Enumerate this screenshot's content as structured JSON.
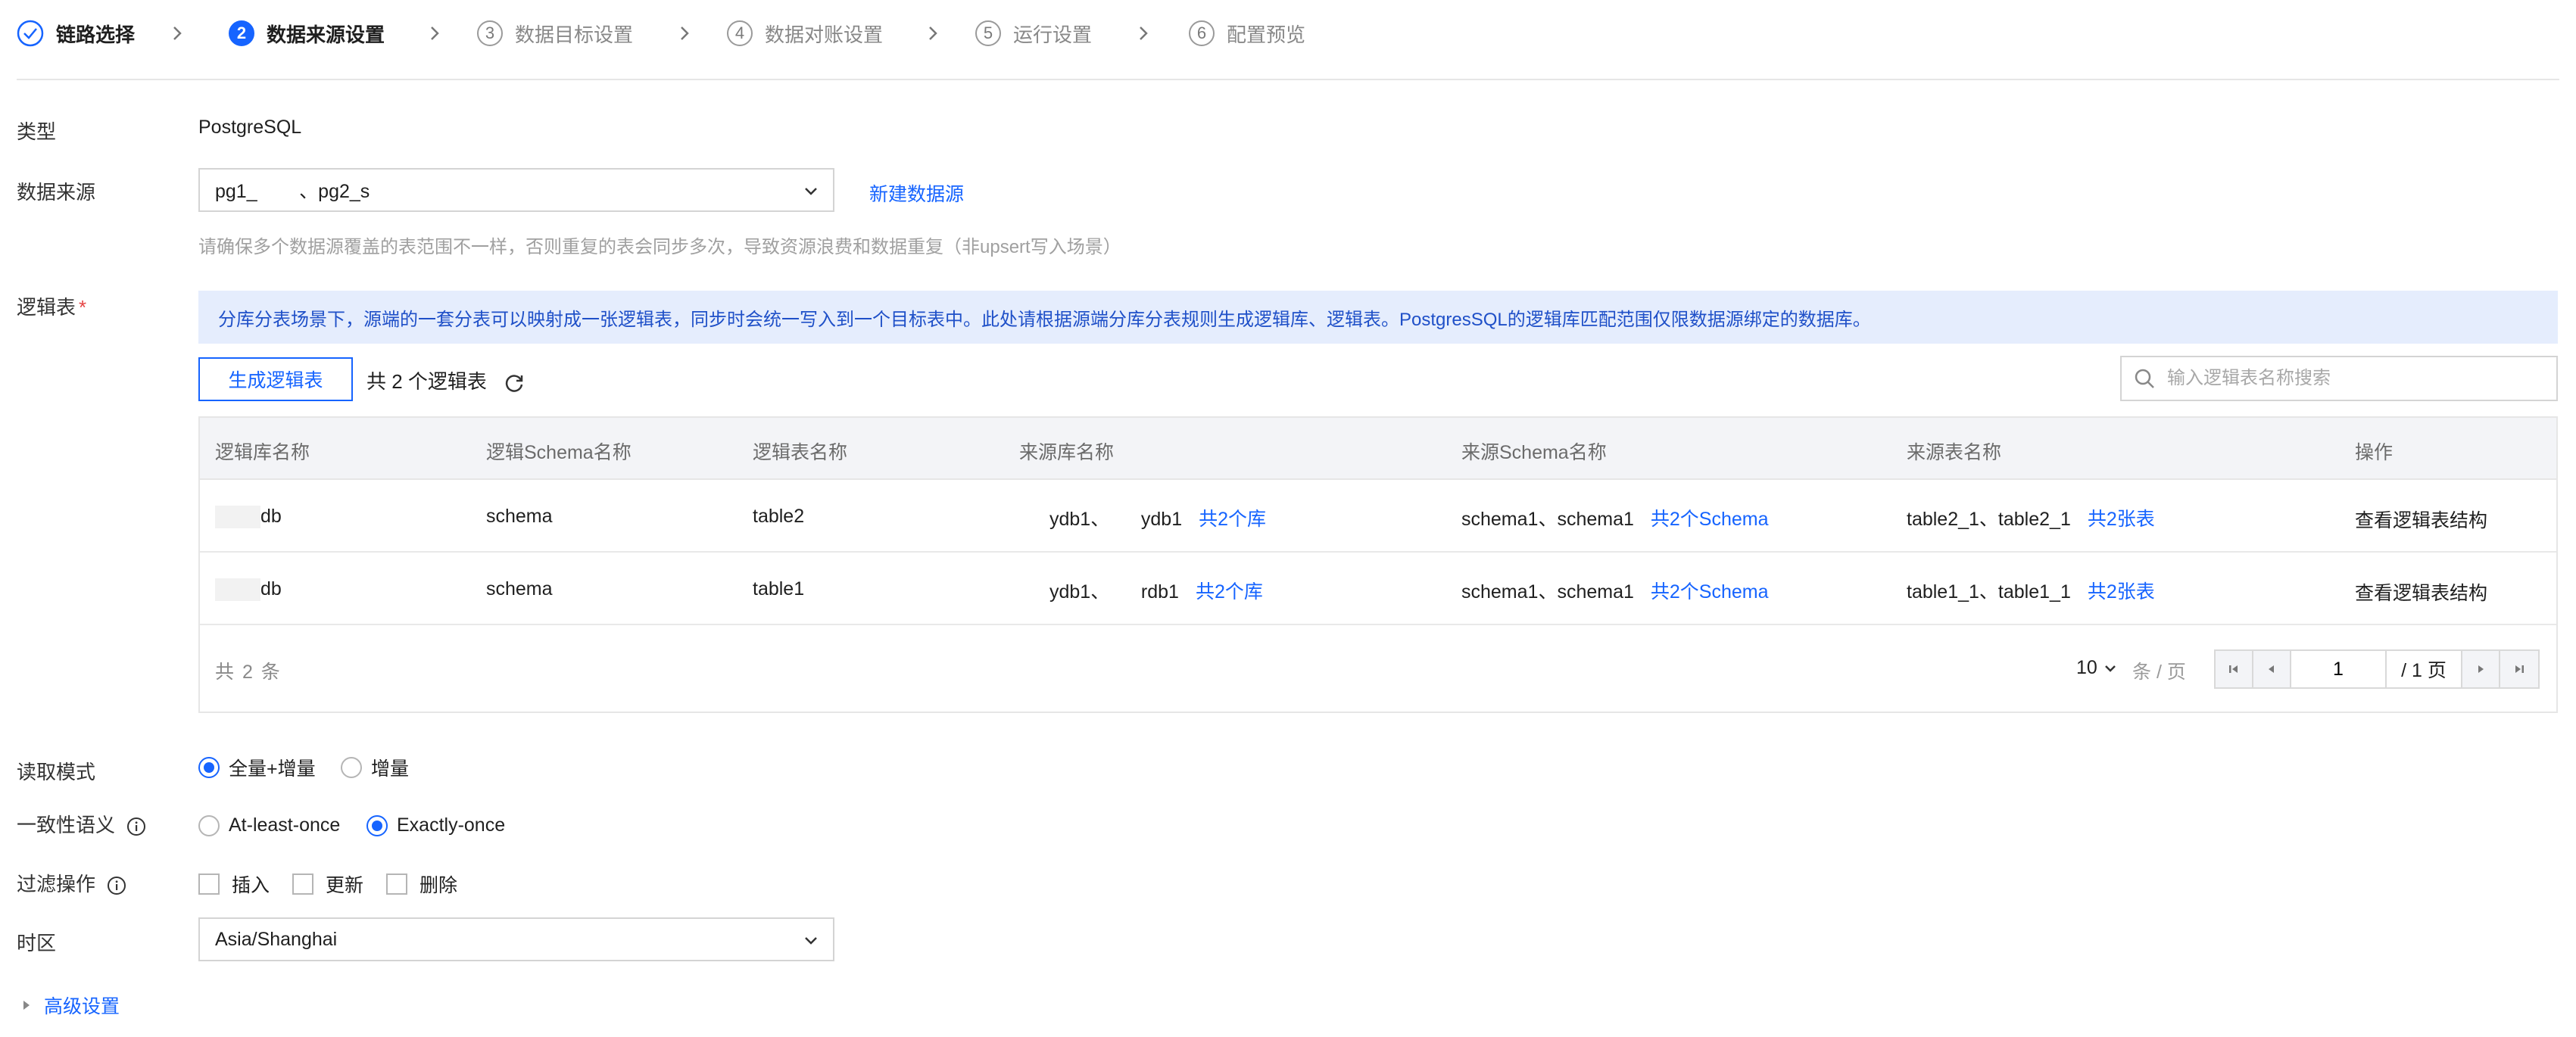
{
  "steps": [
    {
      "label": "链路选择",
      "state": "done"
    },
    {
      "number": "2",
      "label": "数据来源设置",
      "state": "active"
    },
    {
      "number": "3",
      "label": "数据目标设置",
      "state": "pending"
    },
    {
      "number": "4",
      "label": "数据对账设置",
      "state": "pending"
    },
    {
      "number": "5",
      "label": "运行设置",
      "state": "pending"
    },
    {
      "number": "6",
      "label": "配置预览",
      "state": "pending"
    }
  ],
  "form": {
    "type_label": "类型",
    "type_value": "PostgreSQL",
    "datasource_label": "数据来源",
    "datasource_value": "pg1_        、pg2_s",
    "new_datasource_link": "新建数据源",
    "datasource_hint": "请确保多个数据源覆盖的表范围不一样，否则重复的表会同步多次，导致资源浪费和数据重复（非upsert写入场景）",
    "logic_table_label": "逻辑表",
    "required_mark": "*",
    "banner_text": "分库分表场景下，源端的一套分表可以映射成一张逻辑表，同步时会统一写入到一个目标表中。此处请根据源端分库分表规则生成逻辑库、逻辑表。PostgresSQL的逻辑库匹配范围仅限数据源绑定的数据库。",
    "generate_button": "生成逻辑表",
    "table_count": "共 2 个逻辑表",
    "search_placeholder": "输入逻辑表名称搜索"
  },
  "table": {
    "columns": [
      "逻辑库名称",
      "逻辑Schema名称",
      "逻辑表名称",
      "来源库名称",
      "来源Schema名称",
      "来源表名称",
      "操作"
    ],
    "rows": [
      {
        "db": "db",
        "schema": "schema",
        "table": "table2",
        "source_db": "ydb1、      ydb1",
        "source_db_link": "共2个库",
        "source_schema": "schema1、schema1",
        "source_schema_link": "共2个Schema",
        "source_table": "table2_1、table2_1",
        "source_table_link": "共2张表",
        "action": "查看逻辑表结构"
      },
      {
        "db": "db",
        "schema": "schema",
        "table": "table1",
        "source_db": "ydb1、      rdb1",
        "source_db_link": "共2个库",
        "source_schema": "schema1、schema1",
        "source_schema_link": "共2个Schema",
        "source_table": "table1_1、table1_1",
        "source_table_link": "共2张表",
        "action": "查看逻辑表结构"
      }
    ],
    "total": "共 2 条",
    "page_size": "10",
    "per_page_text": "条 / 页",
    "current_page": "1",
    "total_pages": "/ 1 页"
  },
  "read_mode": {
    "label": "读取模式",
    "options": [
      "全量+增量",
      "增量"
    ],
    "selected": "全量+增量"
  },
  "consistency": {
    "label": "一致性语义",
    "options": [
      "At-least-once",
      "Exactly-once"
    ],
    "selected": "Exactly-once"
  },
  "filter_ops": {
    "label": "过滤操作",
    "options": [
      "插入",
      "更新",
      "删除"
    ]
  },
  "timezone": {
    "label": "时区",
    "value": "Asia/Shanghai"
  },
  "advanced": {
    "label": "高级设置"
  },
  "colors": {
    "primary": "#1664ff",
    "banner_bg": "#e5edfd",
    "required": "#e54545"
  },
  "icons": [
    "check-circle-icon",
    "chevron-right-icon",
    "chevron-down-icon",
    "refresh-icon",
    "search-icon",
    "info-icon",
    "first-page-icon",
    "prev-page-icon",
    "next-page-icon",
    "last-page-icon",
    "caret-right-icon"
  ]
}
